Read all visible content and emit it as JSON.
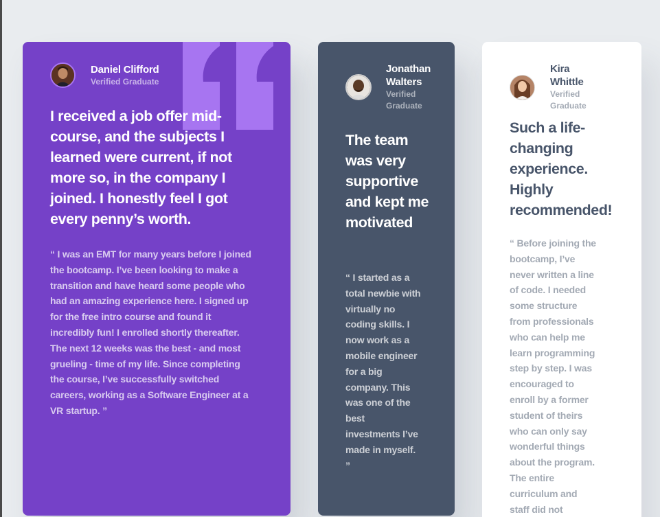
{
  "colors": {
    "page_background": "#e9ecef",
    "moderate_violet": "#7541c8",
    "grayish_blue": "#48556a",
    "white": "#ffffff",
    "light_violet_quote": "#a775f1"
  },
  "testimonials": [
    {
      "name": "Daniel Clifford",
      "role": "Verified Graduate",
      "avatar": "avatar-daniel",
      "headline": "I received a job offer mid-course, and the subjects I learned were current, if not more so, in the company I joined. I honestly feel I got every penny’s worth.",
      "body": "“ I was an EMT for many years before I joined the bootcamp. I’ve been looking to make a transition and have heard some people who had an amazing experience here. I signed up for the free intro course and found it incredibly fun! I enrolled shortly thereafter. The next 12 weeks was the best - and most grueling - time of my life. Since completing the course, I’ve successfully switched careers, working as a Software Engineer at a VR startup. ”"
    },
    {
      "name": "Jonathan Walters",
      "role": "Verified Graduate",
      "avatar": "avatar-jonathan",
      "headline": "The team was very supportive and kept me motivated",
      "body": "“ I started as a total newbie with virtually no coding skills. I now work as a mobile engineer for a big company. This was one of the best investments I’ve made in myself. ”"
    },
    {
      "name": "Kira Whittle",
      "role": "Verified Graduate",
      "avatar": "avatar-kira",
      "headline": "Such a life-changing experience. Highly recommended!",
      "body": "“ Before joining the bootcamp, I’ve never written a line of code. I needed some structure from professionals who can help me learn programming step by step. I was encouraged to enroll by a former student of theirs who can only say wonderful things about the program. The entire curriculum and staff did not disappoint."
    }
  ]
}
